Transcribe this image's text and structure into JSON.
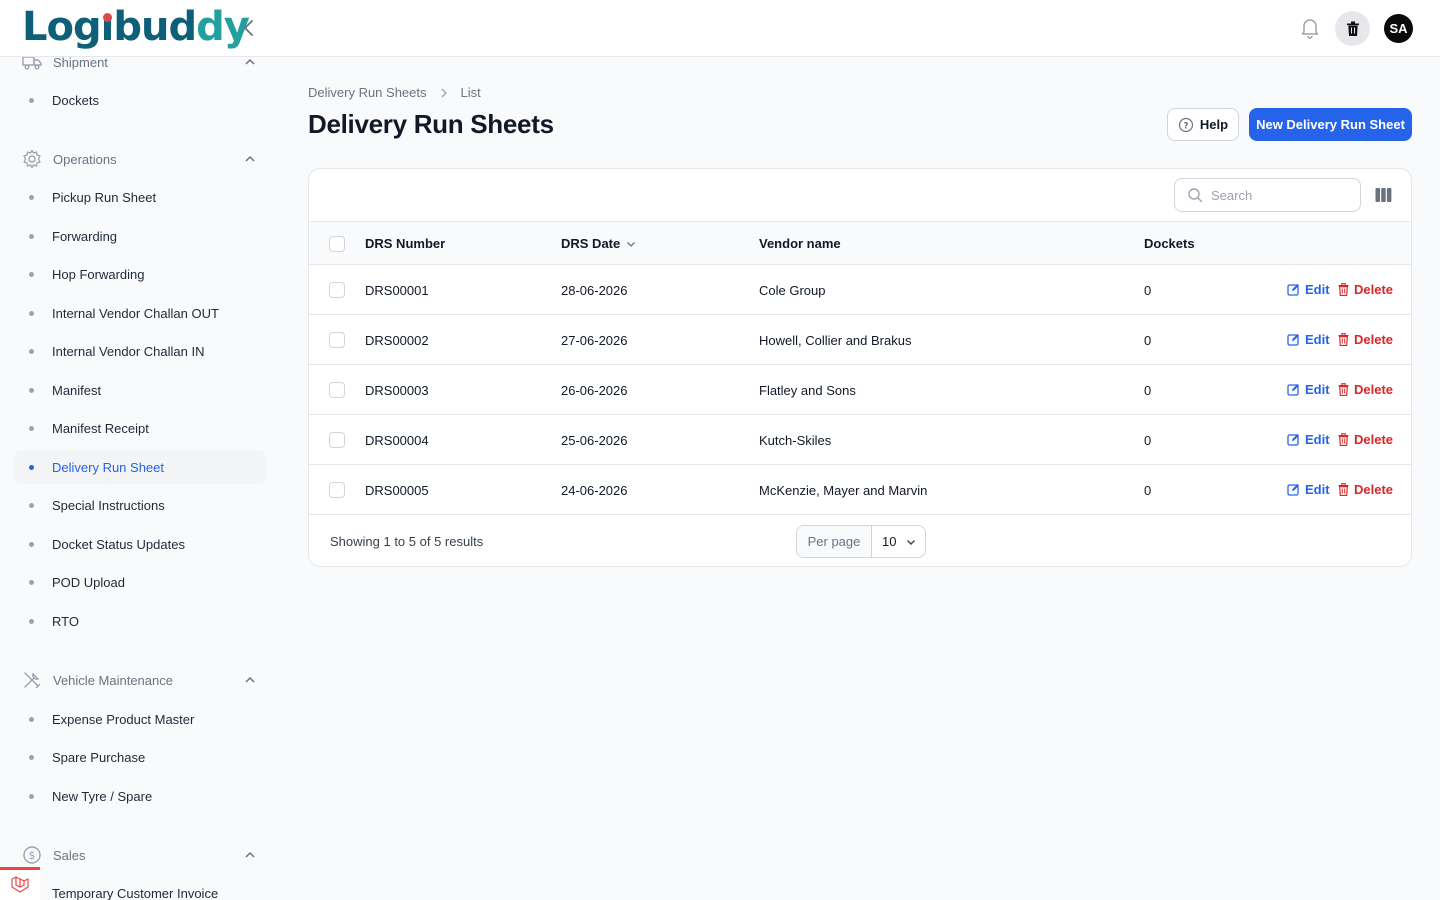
{
  "app": {
    "logo_text": "Logibuddy"
  },
  "topbar": {
    "avatar_initials": "SA"
  },
  "sidebar": {
    "groups": [
      {
        "label": "Shipment",
        "icon": "truck-icon",
        "items": [
          {
            "label": "Dockets"
          }
        ]
      },
      {
        "label": "Operations",
        "icon": "gear-icon",
        "items": [
          {
            "label": "Pickup Run Sheet"
          },
          {
            "label": "Forwarding"
          },
          {
            "label": "Hop Forwarding"
          },
          {
            "label": "Internal Vendor Challan OUT"
          },
          {
            "label": "Internal Vendor Challan IN"
          },
          {
            "label": "Manifest"
          },
          {
            "label": "Manifest Receipt"
          },
          {
            "label": "Delivery Run Sheet",
            "active": true
          },
          {
            "label": "Special Instructions"
          },
          {
            "label": "Docket Status Updates"
          },
          {
            "label": "POD Upload"
          },
          {
            "label": "RTO"
          }
        ]
      },
      {
        "label": "Vehicle Maintenance",
        "icon": "wrench-screwdriver-icon",
        "items": [
          {
            "label": "Expense Product Master"
          },
          {
            "label": "Spare Purchase"
          },
          {
            "label": "New Tyre / Spare"
          }
        ]
      },
      {
        "label": "Sales",
        "icon": "dollar-circle-icon",
        "items": [
          {
            "label": "Temporary Customer Invoice"
          }
        ]
      }
    ]
  },
  "breadcrumb": {
    "parent": "Delivery Run Sheets",
    "current": "List"
  },
  "page": {
    "title": "Delivery Run Sheets",
    "help_label": "Help",
    "new_label": "New Delivery Run Sheet"
  },
  "table": {
    "search_placeholder": "Search",
    "columns": {
      "drs_number": "DRS Number",
      "drs_date": "DRS Date",
      "vendor": "Vendor name",
      "dockets": "Dockets"
    },
    "rows": [
      {
        "drs_number": "DRS00001",
        "drs_date": "28-06-2026",
        "vendor": "Cole Group",
        "dockets": "0"
      },
      {
        "drs_number": "DRS00002",
        "drs_date": "27-06-2026",
        "vendor": "Howell, Collier and Brakus",
        "dockets": "0"
      },
      {
        "drs_number": "DRS00003",
        "drs_date": "26-06-2026",
        "vendor": "Flatley and Sons",
        "dockets": "0"
      },
      {
        "drs_number": "DRS00004",
        "drs_date": "25-06-2026",
        "vendor": "Kutch-Skiles",
        "dockets": "0"
      },
      {
        "drs_number": "DRS00005",
        "drs_date": "24-06-2026",
        "vendor": "McKenzie, Mayer and Marvin",
        "dockets": "0"
      }
    ],
    "edit_label": "Edit",
    "delete_label": "Delete",
    "footer_text": "Showing 1 to 5 of 5 results",
    "per_page_label": "Per page",
    "per_page_value": "10"
  },
  "colors": {
    "primary": "#2563eb",
    "danger": "#dc2626",
    "logo_teal": "#0e5f78",
    "logo_dot": "#e04848"
  }
}
